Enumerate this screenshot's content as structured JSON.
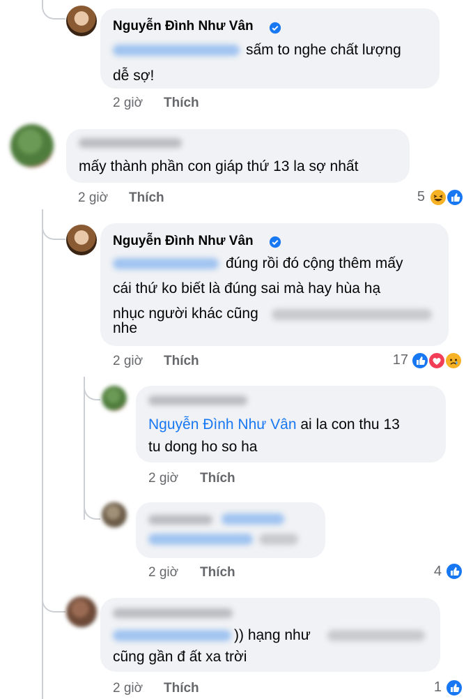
{
  "comments": [
    {
      "id": "c1",
      "author": "Nguyễn Đình Như Vân",
      "verified": true,
      "mention": "",
      "lines": [
        "sấm to nghe chất lượng",
        "dễ sợ!"
      ],
      "time": "2 giờ",
      "like_label": "Thích"
    },
    {
      "id": "c2",
      "author": "",
      "lines": [
        "mấy thành phần con giáp thứ 13 la sợ nhất"
      ],
      "time": "2 giờ",
      "like_label": "Thích",
      "reaction_count": "5",
      "reactions": [
        "haha-icon",
        "like-icon"
      ]
    },
    {
      "id": "c3",
      "author": "Nguyễn Đình Như Vân",
      "verified": true,
      "lines": [
        "đúng rồi đó cộng thêm mấy",
        "cái thứ ko biết là đúng sai mà hay hùa hạ",
        "nhục người khác cũng",
        "nhe"
      ],
      "time": "2 giờ",
      "like_label": "Thích",
      "reaction_count": "17",
      "reactions": [
        "like-icon",
        "love-icon",
        "sad-icon"
      ]
    },
    {
      "id": "c4",
      "author": "",
      "mention": "Nguyễn Đình Như Vân",
      "lines": [
        "ai la con thu 13",
        "tu dong ho so ha"
      ],
      "time": "2 giờ",
      "like_label": "Thích"
    },
    {
      "id": "c5",
      "author": "",
      "lines": [],
      "time": "2 giờ",
      "like_label": "Thích",
      "reaction_count": "4",
      "reactions": [
        "like-icon"
      ]
    },
    {
      "id": "c6",
      "author": "",
      "lines": [
        ")) hạng như",
        "cũng gần đ ất xa trời"
      ],
      "time": "2 giờ",
      "like_label": "Thích",
      "reaction_count": "1",
      "reactions": [
        "like-icon"
      ]
    }
  ],
  "colors": {
    "bubble": "#f0f2f5",
    "link": "#1877f2",
    "meta": "#65676b",
    "like": "#1877f2",
    "love": "#f33e58",
    "haha": "#f7b125"
  }
}
